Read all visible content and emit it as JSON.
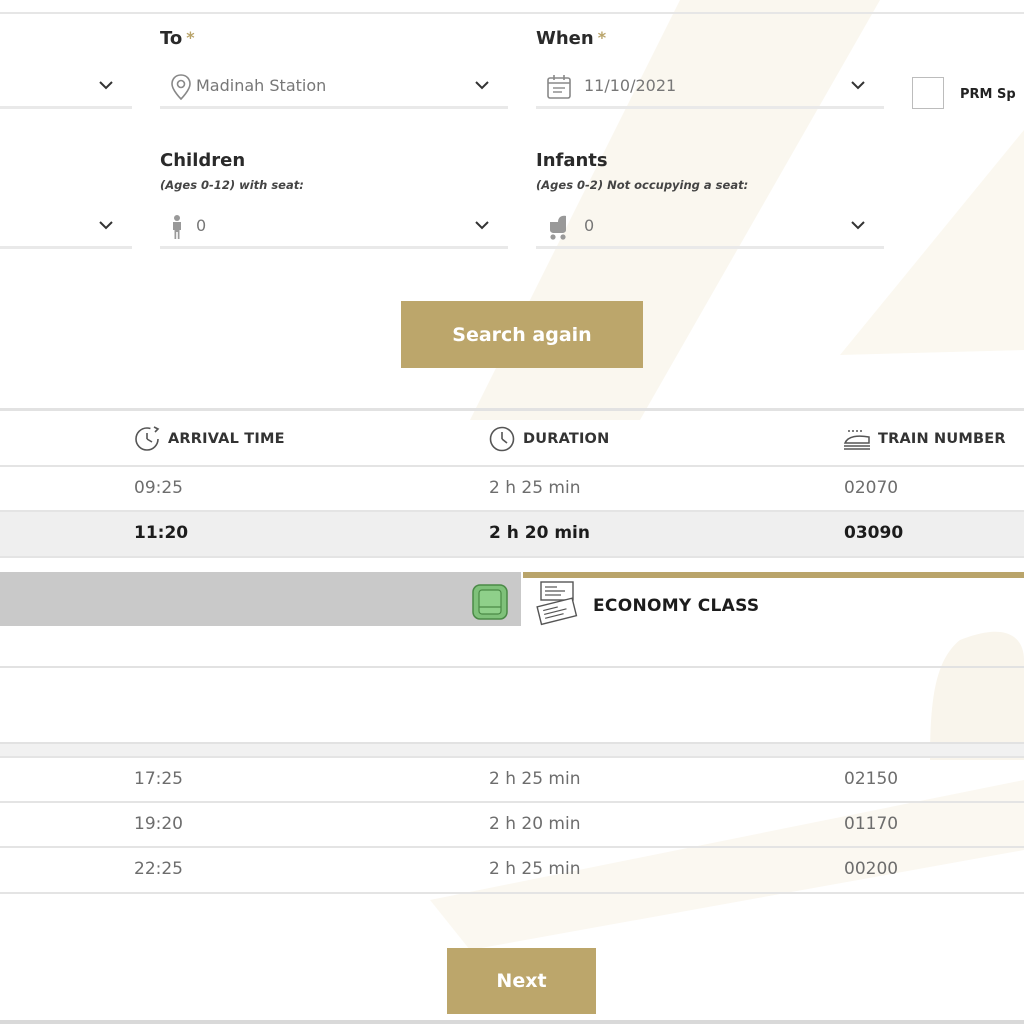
{
  "search_form": {
    "to": {
      "label": "To",
      "required_mark": "*",
      "value": "Madinah Station"
    },
    "when": {
      "label": "When",
      "required_mark": "*",
      "value": "11/10/2021"
    },
    "prm": {
      "label": "PRM Sp"
    },
    "children": {
      "label": "Children",
      "sublabel": "(Ages 0-12) with seat:",
      "value": "0"
    },
    "infants": {
      "label": "Infants",
      "sublabel": "(Ages 0-2) Not occupying a seat:",
      "value": "0"
    },
    "search_again_label": "Search again"
  },
  "results_table": {
    "headers": {
      "arrival_time": "ARRIVAL TIME",
      "duration": "DURATION",
      "train_number": "TRAIN NUMBER"
    },
    "rows_top": [
      {
        "arrival": "09:25",
        "duration": "2 h 25 min",
        "train": "02070"
      },
      {
        "arrival": "11:20",
        "duration": "2 h 20 min",
        "train": "03090"
      }
    ],
    "rows_bottom": [
      {
        "arrival": "17:25",
        "duration": "2 h 25 min",
        "train": "02150"
      },
      {
        "arrival": "19:20",
        "duration": "2 h 20 min",
        "train": "01170"
      },
      {
        "arrival": "22:25",
        "duration": "2 h 25 min",
        "train": "00200"
      }
    ]
  },
  "class_selector": {
    "economy_label": "ECONOMY CLASS"
  },
  "footer": {
    "next_label": "Next"
  },
  "colors": {
    "accent_gold": "#bca66b",
    "selected_row": "#efefef",
    "seat_green": "#7fc17a"
  },
  "icons": {
    "location": "location-pin-icon",
    "calendar": "calendar-icon",
    "child": "child-icon",
    "stroller": "stroller-icon",
    "arrival": "arrival-clock-icon",
    "duration": "clock-icon",
    "train": "train-icon",
    "seat": "seat-icon",
    "tickets": "tickets-icon",
    "dropdown": "chevron-down-icon"
  }
}
